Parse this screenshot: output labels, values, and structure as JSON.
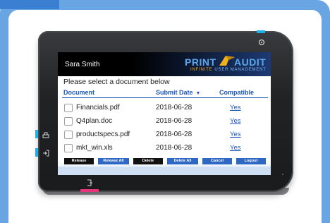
{
  "colors": {
    "frame": "#6aa5e3",
    "header_gradient_end": "#1d3a74",
    "brand_blue": "#5ba8ef",
    "brand_gold": "#f0b21a",
    "link_blue": "#1c57b8",
    "led_cyan": "#20b0e8",
    "led_magenta": "#e8327a"
  },
  "device": {
    "icons": {
      "top_right": "settings-icon",
      "left_top": "printer-icon",
      "left_bottom": "login-icon",
      "bottom": "logout-icon"
    }
  },
  "header": {
    "user_name": "Sara Smith",
    "brand_print": "PRINT",
    "brand_audit": "AUDIT",
    "brand_sub_infinite": "INFINITE",
    "brand_sub_rest": "USER MANAGEMENT"
  },
  "main": {
    "prompt": "Please select a document below",
    "columns": {
      "document": "Document",
      "submit_date": "Submit Date",
      "sort_indicator": "▼",
      "compatible": "Compatible"
    },
    "rows": [
      {
        "name": "Financials.pdf",
        "date": "2018-06-28",
        "compatible": "Yes"
      },
      {
        "name": "Q4plan.doc",
        "date": "2018-06-28",
        "compatible": "Yes"
      },
      {
        "name": "productspecs.pdf",
        "date": "2018-06-28",
        "compatible": "Yes"
      },
      {
        "name": "mkt_win.xls",
        "date": "2018-06-28",
        "compatible": "Yes"
      }
    ]
  },
  "buttons": {
    "release": "Release",
    "release_all": "Release All",
    "delete": "Delete",
    "delete_all": "Delete All",
    "cancel": "Cancel",
    "logout": "Logout"
  }
}
